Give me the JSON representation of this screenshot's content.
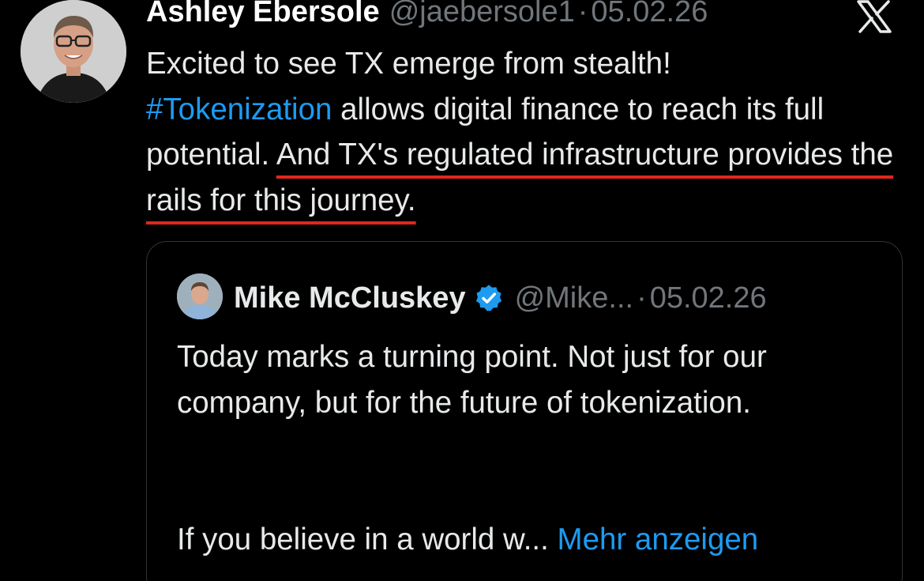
{
  "tweet": {
    "author_name": "Ashley Ebersole",
    "author_handle": "@jaebersole1",
    "separator": "·",
    "date": "05.02.26",
    "text_part1": "Excited to see TX emerge from stealth!",
    "hashtag": "#Tokenization",
    "text_part2": " allows digital finance to reach its full potential. ",
    "underlined_text": "And TX's regulated infrastructure provides the rails for this journey.",
    "annotation_color": "#e0261b"
  },
  "quote": {
    "author_name": "Mike McCluskey",
    "author_handle": "@Mike...",
    "separator": "·",
    "date": "05.02.26",
    "text_paragraph1": "Today marks a turning point. Not just for our company, but for the future of tokenization.",
    "text_truncated": "If you believe in a world w...",
    "show_more_label": "Mehr anzeigen",
    "verified_icon": "verified-badge-icon"
  },
  "colors": {
    "background": "#000000",
    "link": "#1d9bf0",
    "muted": "#71767b",
    "text": "#e7e9ea",
    "border": "#2f3336"
  }
}
